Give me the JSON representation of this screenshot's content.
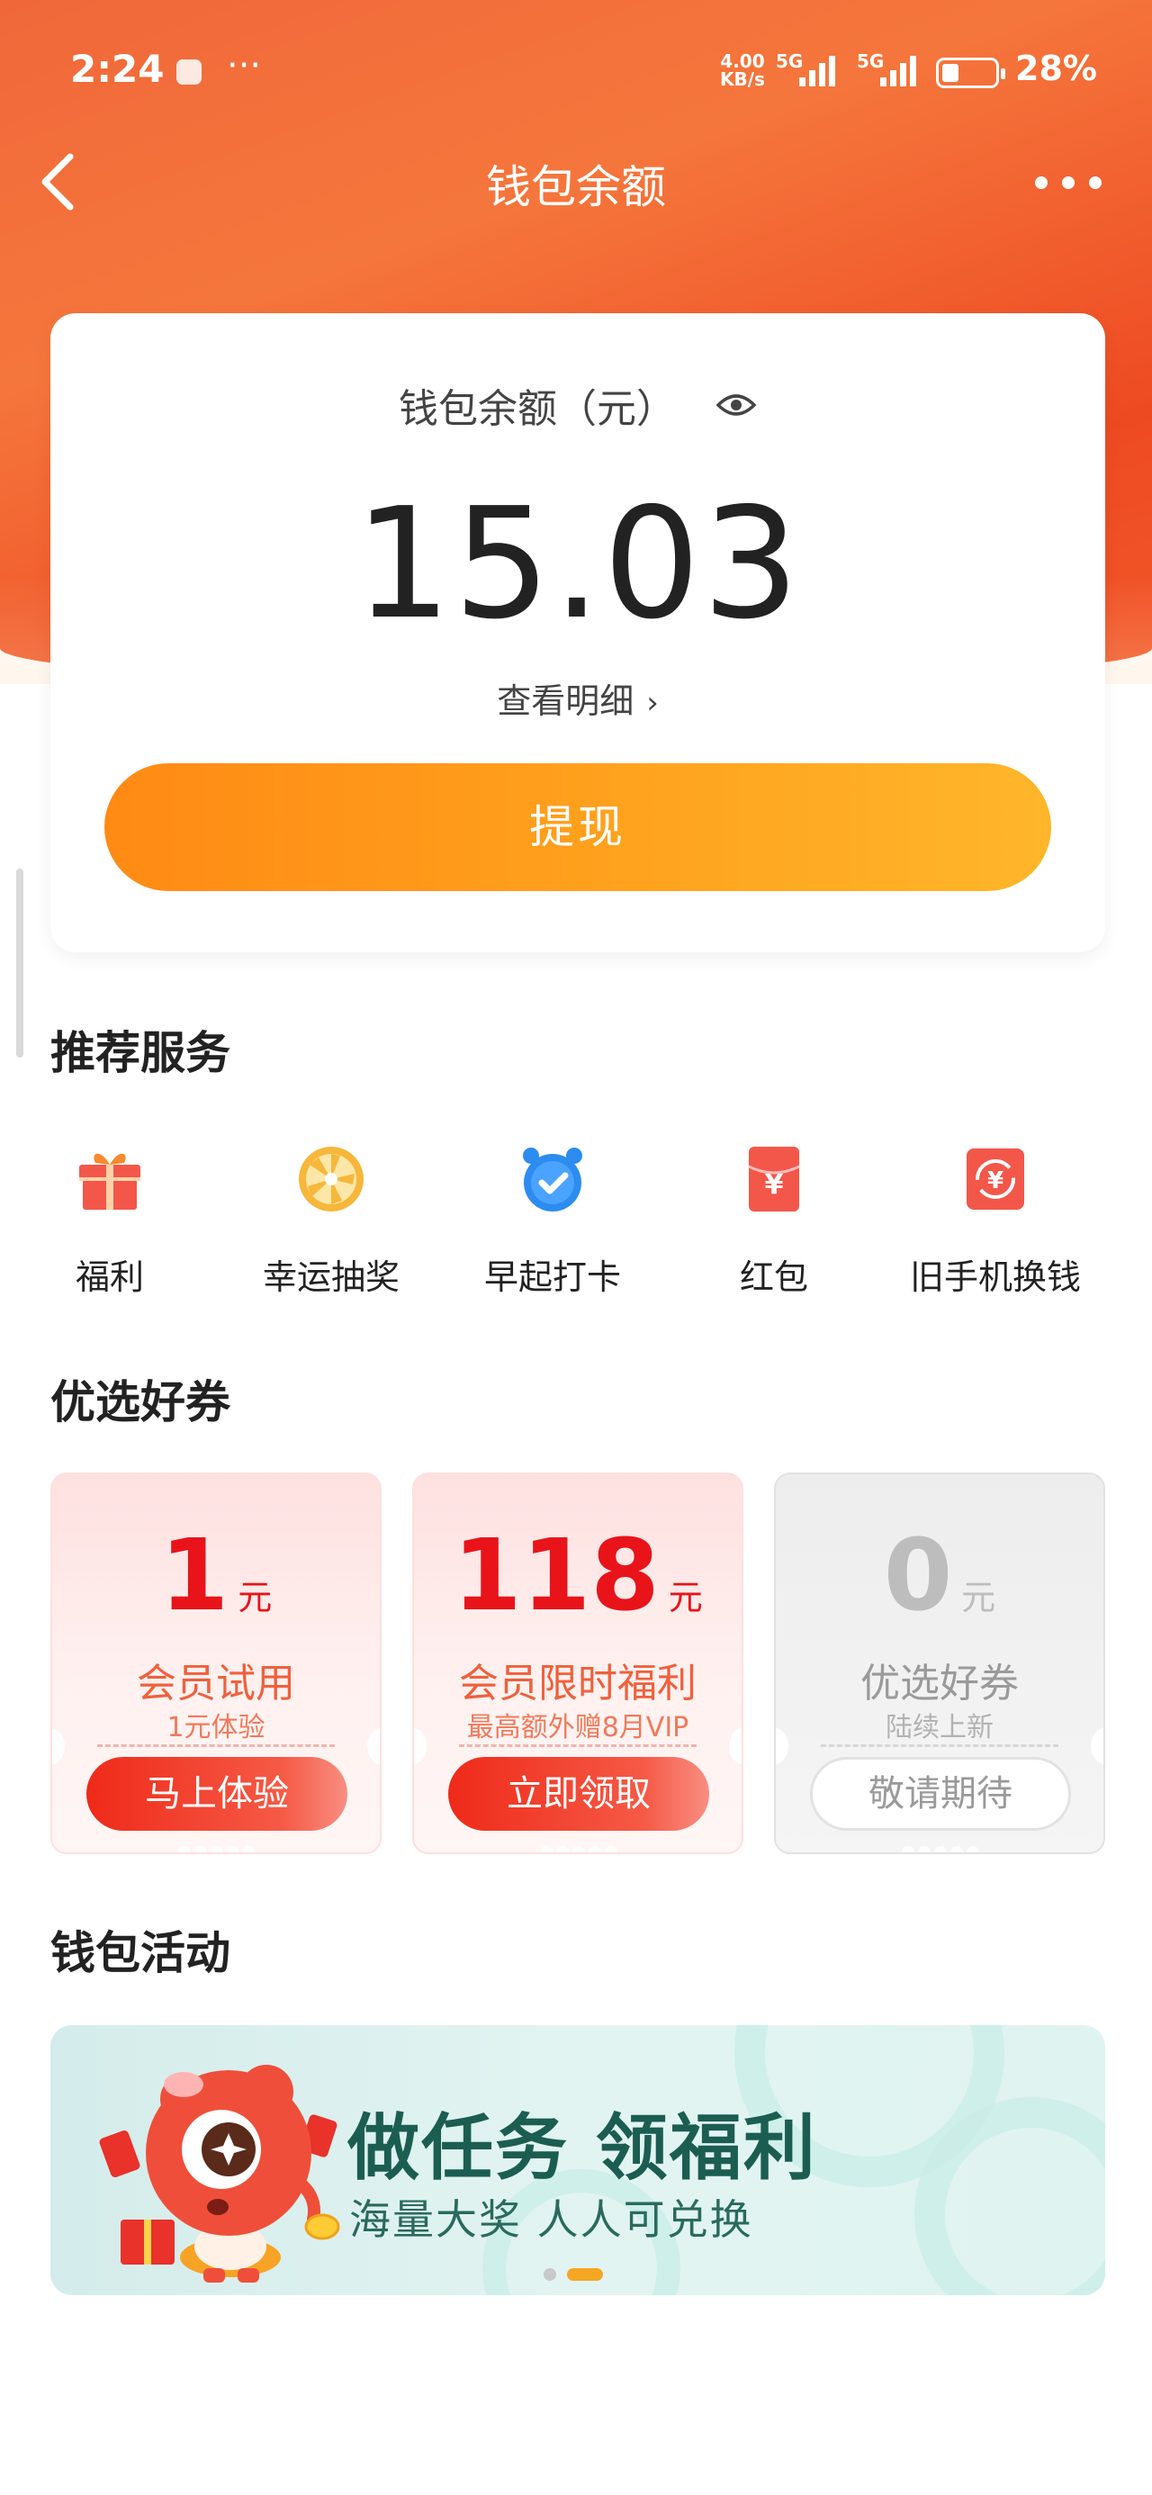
{
  "status_bar": {
    "time": "2:24",
    "net_speed_top": "4.00",
    "net_speed_bottom": "KB/s",
    "sim1": "5G",
    "sim2": "5G",
    "battery": "28%"
  },
  "nav": {
    "title": "钱包余额",
    "back_icon": "chevron-left-icon",
    "more_icon": "more-dots-icon"
  },
  "balance": {
    "label": "钱包余额（元）",
    "amount": "15.03",
    "detail_link": "查看明细",
    "withdraw_label": "提现"
  },
  "services": {
    "title": "推荐服务",
    "items": [
      {
        "label": "福利",
        "icon": "gift-icon"
      },
      {
        "label": "幸运抽奖",
        "icon": "lottery-wheel-icon"
      },
      {
        "label": "早起打卡",
        "icon": "alarm-clock-icon"
      },
      {
        "label": "红包",
        "icon": "red-envelope-icon"
      },
      {
        "label": "旧手机换钱",
        "icon": "trade-in-icon"
      }
    ]
  },
  "coupons": {
    "title": "优选好券",
    "items": [
      {
        "value": "1",
        "unit": "元",
        "title": "会员试用",
        "subtitle": "1元体验",
        "button": "马上体验"
      },
      {
        "value": "118",
        "unit": "元",
        "title": "会员限时福利",
        "subtitle": "最高额外赠8月VIP",
        "button": "立即领取"
      },
      {
        "value": "0",
        "unit": "元",
        "title": "优选好券",
        "subtitle": "陆续上新",
        "button": "敬请期待"
      }
    ]
  },
  "activities": {
    "title": "钱包活动",
    "banner_title": "做任务 领福利",
    "banner_subtitle": "海量大奖 人人可兑换",
    "carousel_active_index": 1,
    "carousel_count": 2
  },
  "colors": {
    "header_orange": "#f0683a",
    "withdraw_orange": "#ffa21e",
    "coupon_red": "#e8141a",
    "banner_green": "#1c5d52",
    "carousel_active": "#f5a623"
  }
}
